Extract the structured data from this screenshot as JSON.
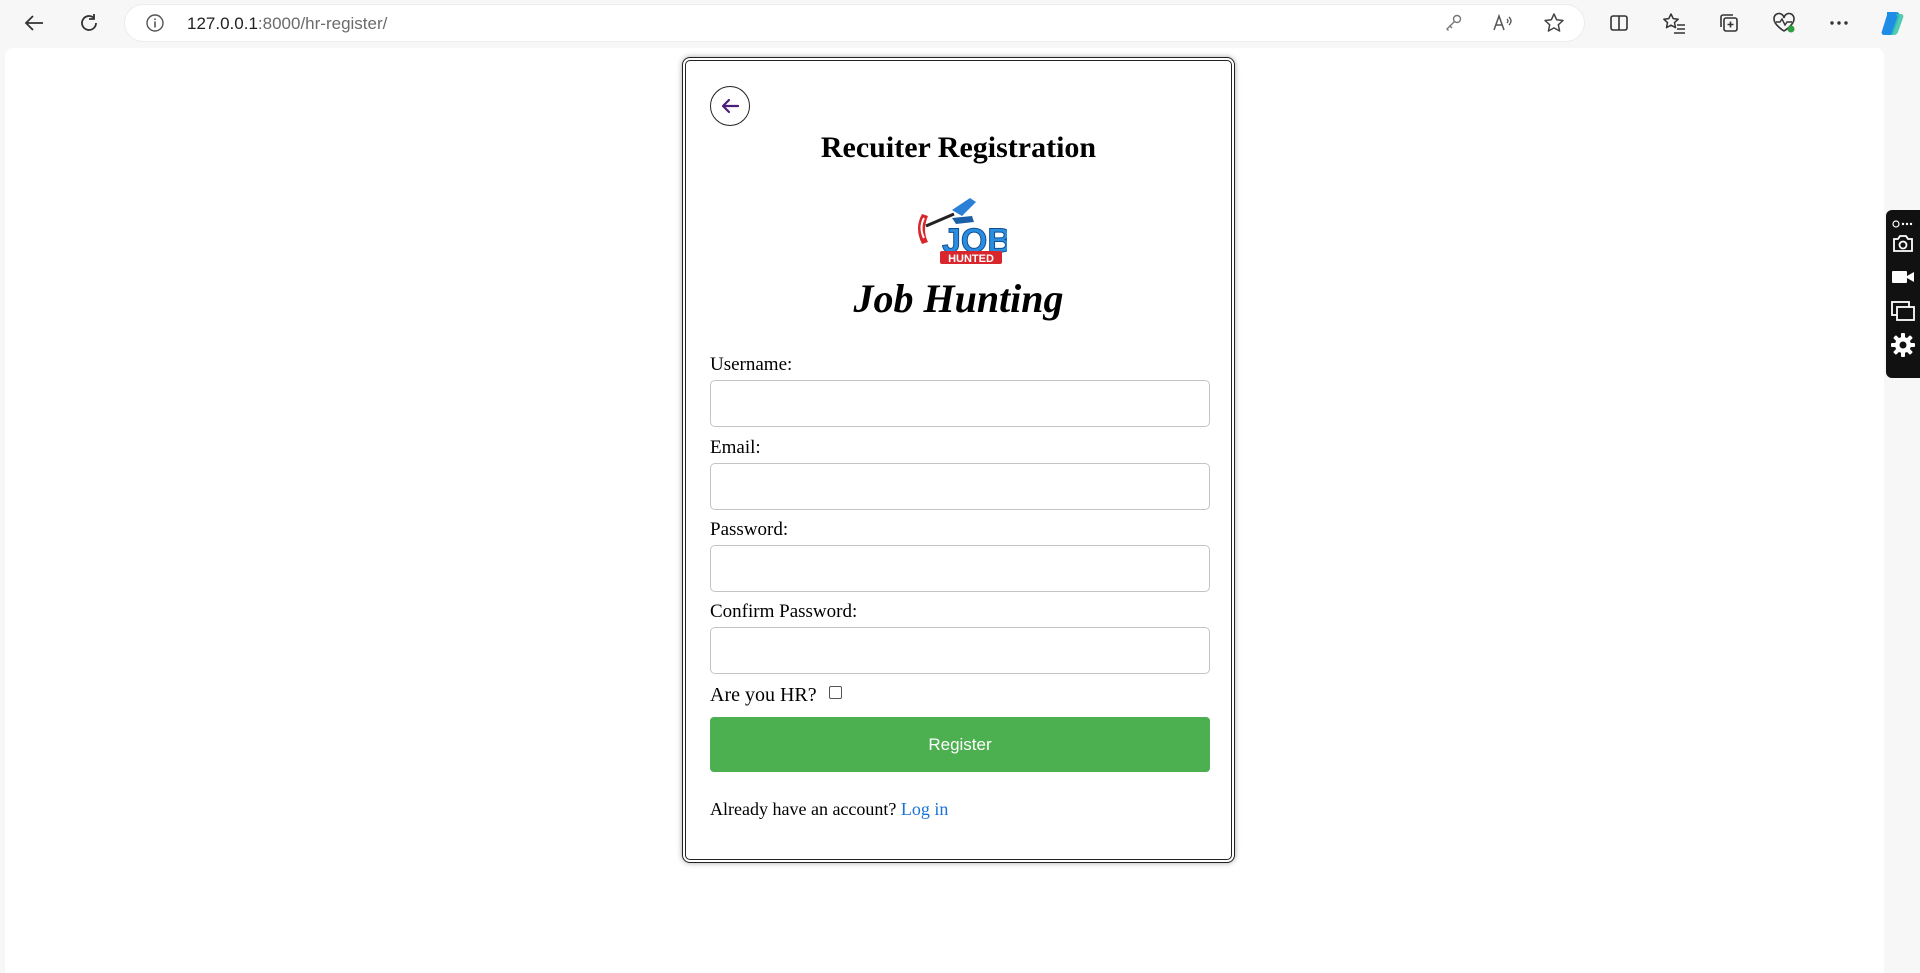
{
  "browser": {
    "url_host": "127.0.0.1",
    "url_path": ":8000/hr-register/",
    "icons": {
      "back": "back-arrow-icon",
      "refresh": "refresh-icon",
      "info": "info-icon",
      "password_key": "key-icon",
      "read_aloud": "read-aloud-icon",
      "favorite": "star-icon",
      "split_screen": "split-screen-icon",
      "favorites": "favorites-icon",
      "collections": "collections-icon",
      "browser_essentials": "heart-pulse-icon",
      "more": "more-icon",
      "copilot": "copilot-icon"
    }
  },
  "side_toolbar": {
    "tools": [
      "camera-icon",
      "video-icon",
      "window-icon",
      "settings-icon"
    ]
  },
  "form": {
    "title": "Recuiter Registration",
    "brand": "Job Hunting",
    "logo_text": "JOB",
    "logo_subtext": "HUNTED",
    "fields": [
      {
        "label": "Username:",
        "value": ""
      },
      {
        "label": "Email:",
        "value": ""
      },
      {
        "label": "Password:",
        "value": ""
      },
      {
        "label": "Confirm Password:",
        "value": ""
      }
    ],
    "hr_question": "Are you HR?",
    "hr_checked": false,
    "submit_label": "Register",
    "login_prompt": "Already have an account?",
    "login_link": "Log in"
  },
  "colors": {
    "submit_bg": "#4caf50",
    "link": "#1a73d6",
    "back_arrow": "#4b1e7a"
  }
}
